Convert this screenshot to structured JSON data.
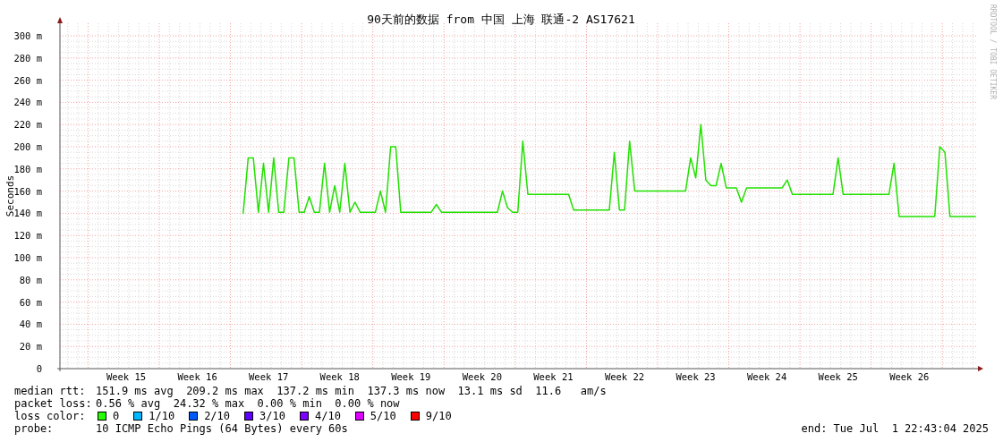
{
  "title": "90天前的数据 from 中国 上海 联通-2 AS17621",
  "credit": "RRDTOOL / TOBI OETIKER",
  "chart_data": {
    "type": "line",
    "ylabel": "Seconds",
    "grid": true,
    "ylim": [
      0,
      300
    ],
    "yticks": [
      {
        "value": 0,
        "label": "0"
      },
      {
        "value": 20,
        "label": "20 m"
      },
      {
        "value": 40,
        "label": "40 m"
      },
      {
        "value": 60,
        "label": "60 m"
      },
      {
        "value": 80,
        "label": "80 m"
      },
      {
        "value": 100,
        "label": "100 m"
      },
      {
        "value": 120,
        "label": "120 m"
      },
      {
        "value": 140,
        "label": "140 m"
      },
      {
        "value": 160,
        "label": "160 m"
      },
      {
        "value": 180,
        "label": "180 m"
      },
      {
        "value": 200,
        "label": "200 m"
      },
      {
        "value": 220,
        "label": "220 m"
      },
      {
        "value": 240,
        "label": "240 m"
      },
      {
        "value": 260,
        "label": "260 m"
      },
      {
        "value": 280,
        "label": "280 m"
      },
      {
        "value": 300,
        "label": "300 m"
      }
    ],
    "categories": [
      null,
      null,
      null,
      null,
      null,
      null,
      null,
      null,
      null,
      null,
      null,
      null,
      "Week 15",
      null,
      null,
      null,
      null,
      null,
      null,
      null,
      null,
      null,
      null,
      null,
      null,
      null,
      "Week 16",
      null,
      null,
      null,
      null,
      null,
      null,
      null,
      null,
      null,
      null,
      null,
      null,
      null,
      "Week 17",
      null,
      null,
      null,
      null,
      null,
      null,
      null,
      null,
      null,
      null,
      null,
      null,
      null,
      "Week 18",
      null,
      null,
      null,
      null,
      null,
      null,
      null,
      null,
      null,
      null,
      null,
      null,
      null,
      "Week 19",
      null,
      null,
      null,
      null,
      null,
      null,
      null,
      null,
      null,
      null,
      null,
      null,
      null,
      "Week 20",
      null,
      null,
      null,
      null,
      null,
      null,
      null,
      null,
      null,
      null,
      null,
      null,
      null,
      "Week 21",
      null,
      null,
      null,
      null,
      null,
      null,
      null,
      null,
      null,
      null,
      null,
      null,
      null,
      "Week 22",
      null,
      null,
      null,
      null,
      null,
      null,
      null,
      null,
      null,
      null,
      null,
      null,
      null,
      "Week 23",
      null,
      null,
      null,
      null,
      null,
      null,
      null,
      null,
      null,
      null,
      null,
      null,
      null,
      "Week 24",
      null,
      null,
      null,
      null,
      null,
      null,
      null,
      null,
      null,
      null,
      null,
      null,
      null,
      "Week 25",
      null,
      null,
      null,
      null,
      null,
      null,
      null,
      null,
      null,
      null,
      null,
      null,
      null,
      "Week 26",
      null,
      null,
      null,
      null,
      null,
      null,
      null,
      null,
      null,
      null,
      null,
      null,
      null
    ],
    "series": [
      {
        "color": "#22e000",
        "values": [
          null,
          null,
          null,
          null,
          null,
          null,
          null,
          null,
          null,
          null,
          null,
          null,
          null,
          null,
          null,
          null,
          null,
          null,
          null,
          null,
          null,
          null,
          null,
          null,
          null,
          null,
          null,
          null,
          null,
          null,
          null,
          null,
          null,
          null,
          null,
          140,
          190,
          190,
          141,
          185,
          141,
          190,
          141,
          141,
          190,
          190,
          141,
          141,
          155,
          141,
          141,
          185,
          141,
          165,
          141,
          185,
          141,
          150,
          141,
          141,
          141,
          141,
          160,
          141,
          200,
          200,
          141,
          141,
          141,
          141,
          141,
          141,
          141,
          148,
          141,
          141,
          141,
          141,
          141,
          141,
          141,
          141,
          141,
          141,
          141,
          141,
          160,
          145,
          141,
          141,
          205,
          157,
          157,
          157,
          157,
          157,
          157,
          157,
          157,
          157,
          143,
          143,
          143,
          143,
          143,
          143,
          143,
          143,
          195,
          143,
          143,
          205,
          160,
          160,
          160,
          160,
          160,
          160,
          160,
          160,
          160,
          160,
          160,
          190,
          172,
          220,
          170,
          165,
          165,
          185,
          163,
          163,
          163,
          150,
          163,
          163,
          163,
          163,
          163,
          163,
          163,
          163,
          170,
          157,
          157,
          157,
          157,
          157,
          157,
          157,
          157,
          157,
          190,
          157,
          157,
          157,
          157,
          157,
          157,
          157,
          157,
          157,
          157,
          185,
          137,
          137,
          137,
          137,
          137,
          137,
          137,
          137,
          200,
          195,
          137,
          137,
          137,
          137,
          137,
          137
        ]
      }
    ]
  },
  "legend": {
    "median_rtt": {
      "label": "median rtt:",
      "text": "151.9 ms avg  209.2 ms max  137.2 ms min  137.3 ms now  13.1 ms sd  11.6   am/s"
    },
    "packet_loss": {
      "label": "packet loss:",
      "text": "0.56 % avg  24.32 % max  0.00 % min  0.00 % now"
    },
    "loss_color": {
      "label": "loss color:",
      "items": [
        {
          "label": "0",
          "color": "#26ff00"
        },
        {
          "label": "1/10",
          "color": "#00b8ff"
        },
        {
          "label": "2/10",
          "color": "#0059ff"
        },
        {
          "label": "3/10",
          "color": "#5e00ff"
        },
        {
          "label": "4/10",
          "color": "#7e00ff"
        },
        {
          "label": "5/10",
          "color": "#dd00ff"
        },
        {
          "label": "9/10",
          "color": "#ff0000"
        }
      ]
    },
    "probe": {
      "label": "probe:",
      "text": "10 ICMP Echo Pings (64 Bytes) every 60s"
    },
    "end": "end: Tue Jul  1 22:43:04 2025"
  }
}
